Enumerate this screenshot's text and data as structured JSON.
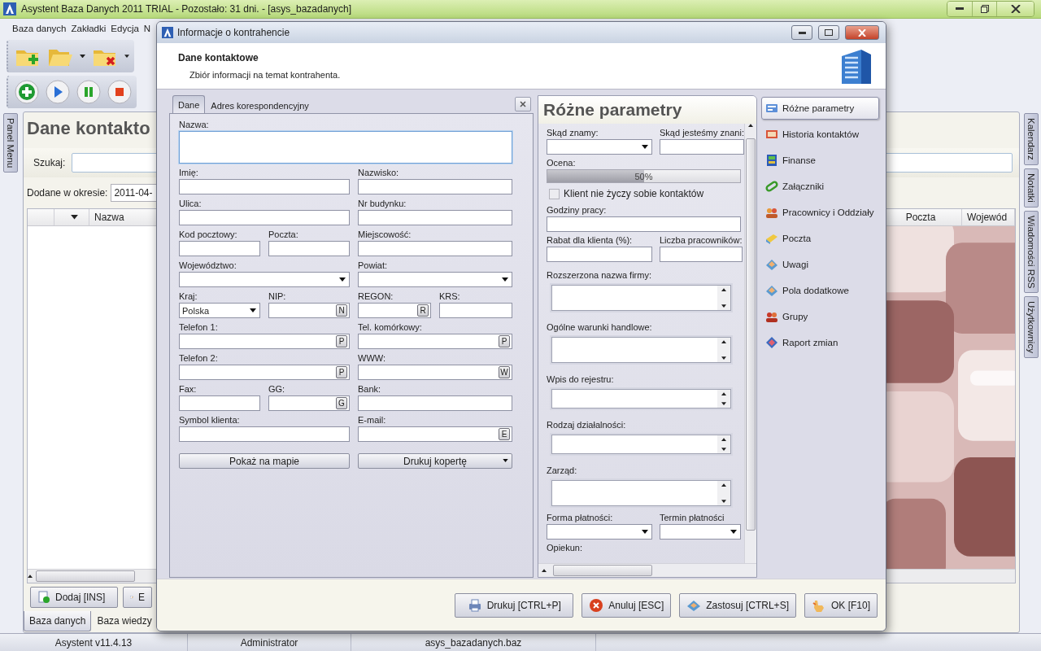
{
  "app": {
    "title": "Asystent Baza Danych 2011 TRIAL - Pozostało: 31 dni. - [asys_bazadanych]",
    "menu": [
      "Baza danych",
      "Zakładki",
      "Edycja",
      "N"
    ],
    "left_tabs": [
      "Panel Menu"
    ],
    "right_tabs": [
      "Kalendarz",
      "Notatki",
      "Wiadomości RSS",
      "Użytkownicy"
    ],
    "panel": {
      "title": "Dane kontakto",
      "search_label": "Szukaj:",
      "period_label": "Dodane w okresie:",
      "period_value": "2011-04-",
      "left_columns": [
        "Nazwa"
      ],
      "right_columns": [
        "Poczta",
        "Wojewód"
      ],
      "buttons": [
        "Dodaj [INS]",
        "E"
      ]
    },
    "bottom_tabs": [
      {
        "label": "Baza danych",
        "selected": true
      },
      {
        "label": "Baza wiedzy",
        "selected": false
      }
    ],
    "status_bar": [
      "Asystent v11.4.13",
      "Administrator",
      "asys_bazadanych.baz"
    ]
  },
  "dialog": {
    "title": "Informacje o kontrahencie",
    "heading": "Dane kontaktowe",
    "subheading": "Zbiór informacji na temat kontrahenta.",
    "tabs": [
      {
        "label": "Dane",
        "selected": true
      },
      {
        "label": "Adres korespondencyjny",
        "selected": false
      }
    ],
    "form_rows": [
      [
        {
          "label": "Nazwa:",
          "kind": "memo",
          "focused": true
        }
      ],
      [
        {
          "label": "Imię:",
          "kind": "text"
        },
        {
          "label": "Nazwisko:",
          "kind": "text"
        }
      ],
      [
        {
          "label": "Ulica:",
          "kind": "text"
        },
        {
          "label": "Nr budynku:",
          "kind": "text"
        }
      ],
      [
        {
          "label": "Kod pocztowy:",
          "kind": "text"
        },
        {
          "label": "Poczta:",
          "kind": "text"
        },
        {
          "label": "Miejscowość:",
          "kind": "text"
        }
      ],
      [
        {
          "label": "Województwo:",
          "kind": "select"
        },
        {
          "label": "Powiat:",
          "kind": "select"
        }
      ],
      [
        {
          "label": "Kraj:",
          "kind": "select",
          "value": "Polska"
        },
        {
          "label": "NIP:",
          "kind": "lookup",
          "key": "N"
        },
        {
          "label": "REGON:",
          "kind": "lookup",
          "key": "R"
        },
        {
          "label": "KRS:",
          "kind": "text"
        }
      ],
      [
        {
          "label": "Telefon 1:",
          "kind": "lookup",
          "key": "P"
        },
        {
          "label": "Tel. komórkowy:",
          "kind": "lookup",
          "key": "P"
        }
      ],
      [
        {
          "label": "Telefon 2:",
          "kind": "lookup",
          "key": "P"
        },
        {
          "label": "WWW:",
          "kind": "lookup",
          "key": "W"
        }
      ],
      [
        {
          "label": "Fax:",
          "kind": "text"
        },
        {
          "label": "GG:",
          "kind": "lookup",
          "key": "G"
        },
        {
          "label": "Bank:",
          "kind": "text"
        }
      ],
      [
        {
          "label": "Symbol klienta:",
          "kind": "text"
        },
        {
          "label": "E-mail:",
          "kind": "lookup",
          "key": "E"
        }
      ]
    ],
    "actions": [
      {
        "label": "Pokaż na mapie",
        "kind": "button"
      },
      {
        "label": "Drukuj kopertę",
        "kind": "menu"
      }
    ],
    "parameters": {
      "title": "Różne parametry",
      "items": [
        {
          "kind": "row",
          "fields": [
            {
              "label": "Skąd znamy:",
              "kind": "select"
            },
            {
              "label": "Skąd jesteśmy znani:",
              "kind": "text"
            }
          ]
        },
        {
          "kind": "rating",
          "label": "Ocena:",
          "level": 0.5,
          "reading": "50%"
        },
        {
          "kind": "checkbox",
          "label": "Klient nie życzy sobie kontaktów",
          "checked": false
        },
        {
          "kind": "row",
          "fields": [
            {
              "label": "Godziny pracy:",
              "kind": "text"
            }
          ]
        },
        {
          "kind": "row",
          "fields": [
            {
              "label": "Rabat dla klienta (%):",
              "kind": "text"
            },
            {
              "label": "Liczba pracowników:",
              "kind": "text"
            }
          ]
        },
        {
          "kind": "memo",
          "label": "Rozszerzona nazwa firmy:"
        },
        {
          "kind": "memo",
          "label": "Ogólne warunki handlowe:"
        },
        {
          "kind": "line-memo",
          "label": "Wpis do rejestru:"
        },
        {
          "kind": "line-memo",
          "label": "Rodzaj działalności:"
        },
        {
          "kind": "memo",
          "label": "Zarząd:"
        },
        {
          "kind": "row",
          "fields": [
            {
              "label": "Forma płatności:",
              "kind": "select"
            },
            {
              "label": "Termin płatności",
              "kind": "select"
            }
          ]
        },
        {
          "kind": "caption",
          "label": "Opiekun:"
        }
      ]
    },
    "nav": [
      {
        "label": "Różne parametry",
        "selected": true
      },
      {
        "label": "Historia kontaktów",
        "selected": false
      },
      {
        "label": "Finanse",
        "selected": false
      },
      {
        "label": "Załączniki",
        "selected": false
      },
      {
        "label": "Pracownicy i Oddziały",
        "selected": false
      },
      {
        "label": "Poczta",
        "selected": false
      },
      {
        "label": "Uwagi",
        "selected": false
      },
      {
        "label": "Pola dodatkowe",
        "selected": false
      },
      {
        "label": "Grupy",
        "selected": false
      },
      {
        "label": "Raport zmian",
        "selected": false
      }
    ],
    "buttons": [
      "Drukuj [CTRL+P]",
      "Anuluj [ESC]",
      "Zastosuj [CTRL+S]",
      "OK [F10]"
    ]
  }
}
